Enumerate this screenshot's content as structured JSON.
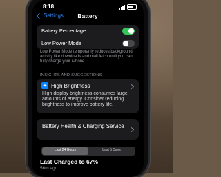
{
  "status_bar": {
    "time": "8:18"
  },
  "nav": {
    "back_label": "Settings",
    "title": "Battery"
  },
  "toggles": [
    {
      "label": "Battery Percentage",
      "on": true
    },
    {
      "label": "Low Power Mode",
      "on": false
    }
  ],
  "low_power_note": "Low Power Mode temporarily reduces background activity like downloads and mail fetch until you can fully charge your iPhone.",
  "insights": {
    "header": "INSIGHTS AND SUGGESTIONS",
    "title": "High Brightness",
    "body": "High display brightness consumes large amounts of energy. Consider reducing brightness to improve battery life."
  },
  "health_link": "Battery Health & Charging Service",
  "range_tabs": [
    {
      "label": "Last 24 Hours",
      "active": true
    },
    {
      "label": "Last 5 Days",
      "active": false
    }
  ],
  "last_charged": {
    "title": "Last Charged to 67%",
    "ago": "56m ago"
  },
  "colors": {
    "accent": "#2f8fff",
    "toggle_on": "#34c759",
    "icon_bg": "#0a84ff"
  },
  "icons": {
    "insight": "sun-icon"
  }
}
